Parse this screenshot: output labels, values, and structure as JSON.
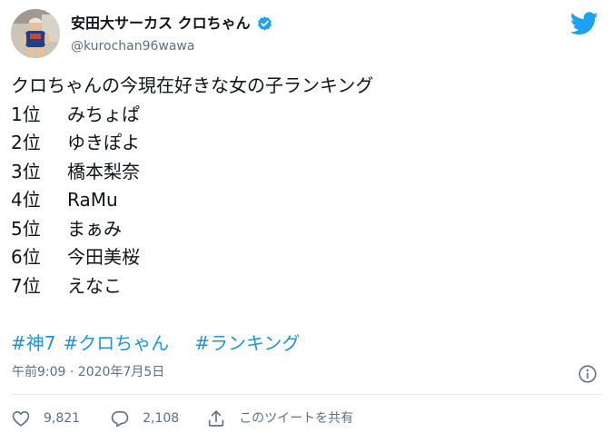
{
  "user": {
    "display_name": "安田大サーカス クロちゃん",
    "handle": "@kurochan96wawa"
  },
  "tweet": {
    "heading": "クロちゃんの今現在好きな女の子ランキング",
    "ranking": [
      {
        "rank": "1位",
        "name": "みちょぱ"
      },
      {
        "rank": "2位",
        "name": "ゆきぽよ"
      },
      {
        "rank": "3位",
        "name": "橋本梨奈"
      },
      {
        "rank": "4位",
        "name": "RaMu"
      },
      {
        "rank": "5位",
        "name": "まぁみ"
      },
      {
        "rank": "6位",
        "name": "今田美桜"
      },
      {
        "rank": "7位",
        "name": "えなこ"
      }
    ],
    "hashtags": [
      "#神7",
      "#クロちゃん",
      "#ランキング"
    ],
    "timestamp": "午前9:09 · 2020年7月5日"
  },
  "actions": {
    "likes": "9,821",
    "replies": "2,108",
    "share_label": "このツイートを共有"
  },
  "icons": {
    "verified": "verified-badge-icon",
    "brand": "twitter-bird-icon",
    "info": "info-icon",
    "like": "heart-icon",
    "reply": "reply-bubble-icon",
    "share": "share-icon"
  },
  "colors": {
    "brand_blue": "#1da1f2",
    "link_blue": "#1b95e0",
    "secondary_text": "#5b7083",
    "primary_text": "#0f1419",
    "divider": "#e6ecf0"
  }
}
